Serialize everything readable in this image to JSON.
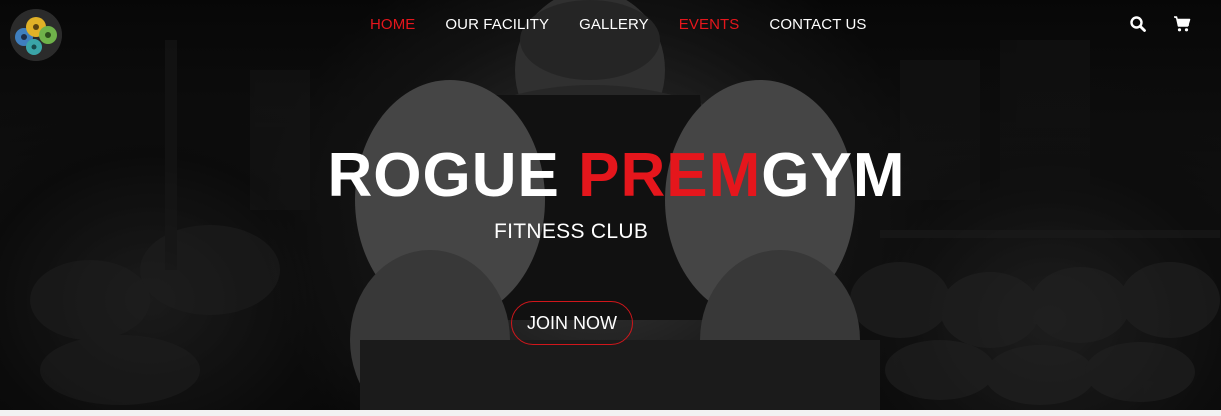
{
  "brand": {
    "logo_icon": "gym-logo-icon"
  },
  "nav": {
    "items": [
      {
        "label": "HOME",
        "active": true
      },
      {
        "label": "OUR FACILITY",
        "active": false
      },
      {
        "label": "GALLERY",
        "active": false
      },
      {
        "label": "EVENTS",
        "active": true
      },
      {
        "label": "CONTACT US",
        "active": false
      }
    ],
    "search_icon": "search-icon",
    "cart_icon": "cart-icon"
  },
  "hero": {
    "title_part1": "ROGUE ",
    "title_part2": "PREM",
    "title_part3": "GYM",
    "subtitle": "FITNESS CLUB",
    "cta_label": "JOIN NOW"
  },
  "colors": {
    "accent": "#e5161c",
    "text": "#ffffff",
    "background": "#1a1a1a"
  }
}
